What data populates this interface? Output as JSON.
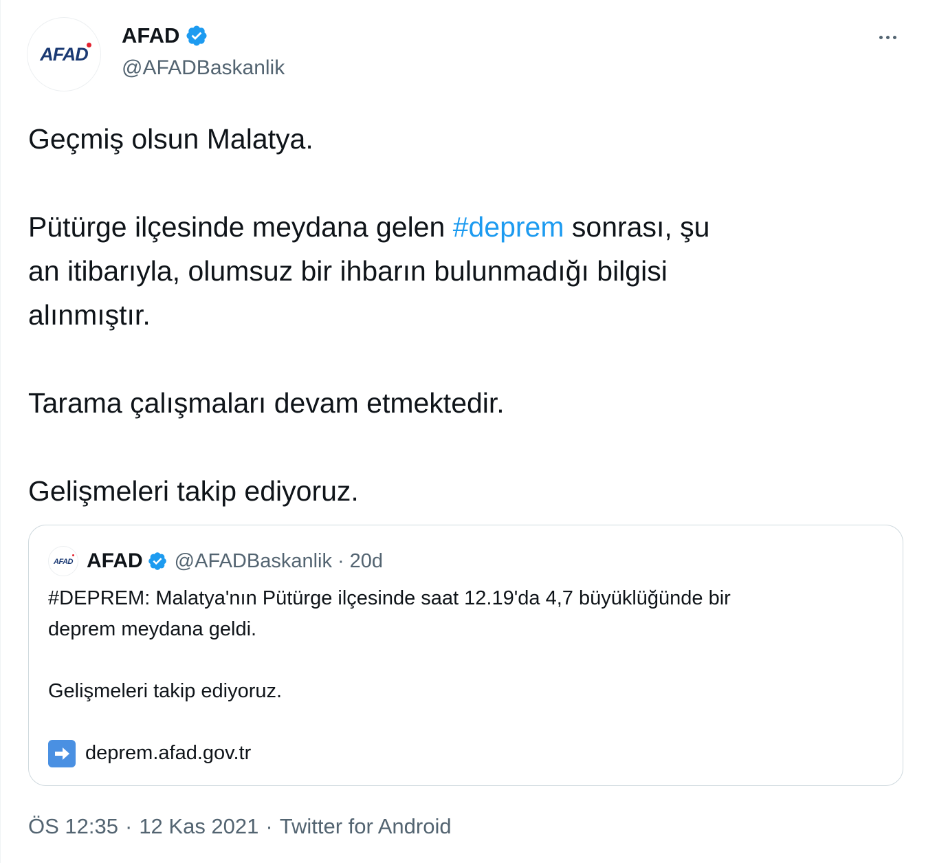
{
  "author": {
    "logo_text": "AFAD",
    "display_name": "AFAD",
    "handle": "@AFADBaskanlik",
    "verified_icon": "verified-badge-icon"
  },
  "tweet": {
    "line1": "Geçmiş olsun Malatya.",
    "para2_pre": "Pütürge ilçesinde meydana gelen ",
    "para2_hashtag": "#deprem",
    "para2_post_line1": " sonrası, şu",
    "para2_line2": "an itibarıyla, olumsuz bir ihbarın bulunmadığı bilgisi",
    "para2_line3": "alınmıştır.",
    "line3": "Tarama çalışmaları devam etmektedir.",
    "line4": "Gelişmeleri takip ediyoruz."
  },
  "quoted_tweet": {
    "logo_text": "AFAD",
    "display_name": "AFAD",
    "handle": "@AFADBaskanlik",
    "separator": "·",
    "age": "20d",
    "text_line1": "#DEPREM: Malatya'nın Pütürge ilçesinde saat 12.19'da 4,7 büyüklüğünde bir",
    "text_line2": "deprem meydana geldi.",
    "text_line3": "Gelişmeleri takip ediyoruz.",
    "link_text": "deprem.afad.gov.tr",
    "link_icon": "right-arrow-icon"
  },
  "meta": {
    "time": "ÖS 12:35",
    "sep": "·",
    "date": "12 Kas 2021",
    "source": "Twitter for Android"
  },
  "colors": {
    "accent": "#1d9bf0",
    "secondary_text": "#536471",
    "border": "#cfd9de",
    "logo_blue": "#1b3a73",
    "logo_red": "#e3212e"
  }
}
